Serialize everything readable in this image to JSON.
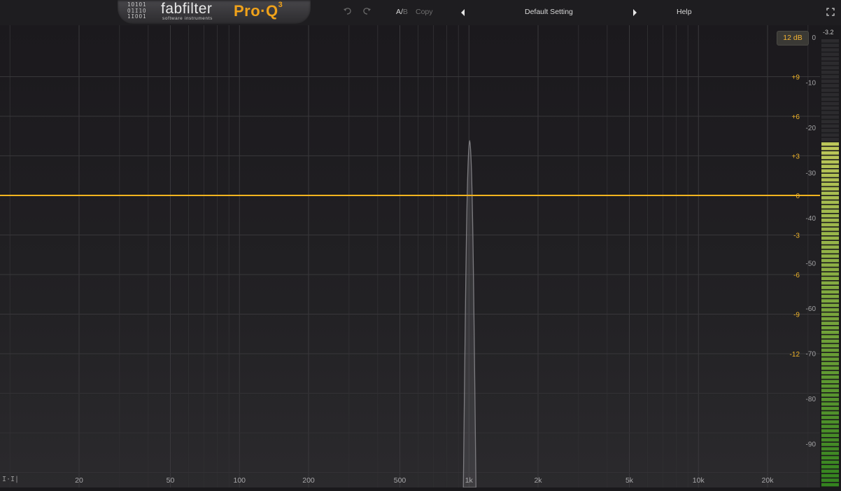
{
  "brand": {
    "binary_rows": [
      "1O1O1",
      "O1I1O",
      "1IOO1"
    ],
    "name": "fabfilter",
    "subtitle": "software instruments",
    "product": "Pro·Q",
    "product_version": "3"
  },
  "toolbar": {
    "ab_label": "A/",
    "ab_b_label": "B",
    "copy_label": "Copy",
    "preset_name": "Default Setting",
    "help_label": "Help"
  },
  "display": {
    "range_label": "12 dB",
    "meter_peak": "-3.2",
    "accent_color": "#f0b428",
    "curve_color": "#f2b41f"
  },
  "freq_axis": {
    "labels": [
      "20",
      "50",
      "100",
      "200",
      "500",
      "1k",
      "2k",
      "5k",
      "10k",
      "20k"
    ],
    "values": [
      20,
      50,
      100,
      200,
      500,
      1000,
      2000,
      5000,
      10000,
      20000
    ],
    "min_hz": 10,
    "max_hz": 30000
  },
  "eq_axis": {
    "labels": [
      "+9",
      "+6",
      "+3",
      "0",
      "-3",
      "-6",
      "-9",
      "-12"
    ],
    "values": [
      9,
      6,
      3,
      0,
      -3,
      -6,
      -9,
      -12
    ],
    "range_db": 12
  },
  "spectrum_axis": {
    "labels": [
      "0",
      "-10",
      "-20",
      "-30",
      "-40",
      "-50",
      "-60",
      "-70",
      "-80",
      "-90"
    ],
    "values": [
      0,
      -10,
      -20,
      -30,
      -40,
      -50,
      -60,
      -70,
      -80,
      -90
    ]
  },
  "spectrum_peak": {
    "freq_hz": 1000,
    "level_db": -23
  },
  "icons": {
    "undo": "undo-icon",
    "redo": "redo-icon",
    "prev": "triangle-left-icon",
    "next": "triangle-right-icon",
    "expand": "fullscreen-icon",
    "corner": "bars-icon"
  }
}
